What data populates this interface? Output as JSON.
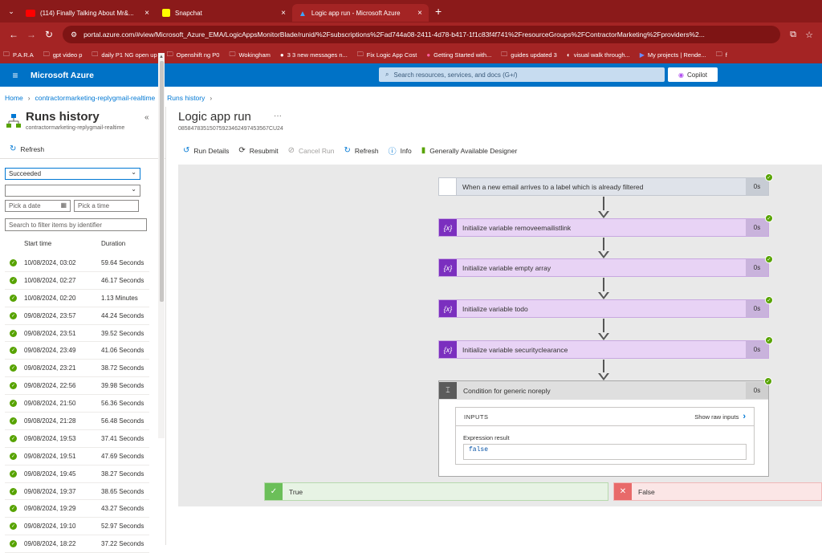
{
  "browser": {
    "tabs": [
      {
        "label": "(114) Finally Talking About Mr&...",
        "icon": "youtube-icon",
        "close": "×"
      },
      {
        "label": "Snapchat",
        "icon": "snapchat-icon",
        "close": "×"
      },
      {
        "label": "Logic app run - Microsoft Azure",
        "icon": "azure-icon",
        "close": "×"
      }
    ],
    "new_tab": "+",
    "url": "portal.azure.com/#view/Microsoft_Azure_EMA/LogicAppsMonitorBlade/runid/%2Fsubscriptions%2Fad744a08-2411-4d78-b417-1f1c83f4f741%2FresourceGroups%2FContractorMarketing%2Fproviders%2...",
    "bookmarks": [
      {
        "label": "P.A.R.A",
        "icon": "folder-icon"
      },
      {
        "label": "gpt video p",
        "icon": "folder-icon"
      },
      {
        "label": "daily P1 NG  open up",
        "icon": "folder-icon"
      },
      {
        "label": "Openshift ng P0",
        "icon": "folder-icon"
      },
      {
        "label": "Wokingham",
        "icon": "folder-icon"
      },
      {
        "label": "3 3 new messages n...",
        "icon": "chat-icon"
      },
      {
        "label": "Fix Logic App Cost",
        "icon": "folder-icon"
      },
      {
        "label": "Getting Started with...",
        "icon": "site-icon"
      },
      {
        "label": "guides updated 3",
        "icon": "folder-icon"
      },
      {
        "label": "visual walk through...",
        "icon": "site-icon"
      },
      {
        "label": "My projects | Rende...",
        "icon": "site-icon"
      },
      {
        "label": "f",
        "icon": "folder-icon"
      }
    ]
  },
  "azure": {
    "brand": "Microsoft Azure",
    "search_placeholder": "Search resources, services, and docs (G+/)",
    "copilot": "Copilot"
  },
  "breadcrumb": [
    "Home",
    "contractormarketing-replygmail-realtime",
    "Runs history"
  ],
  "left": {
    "title": "Runs history",
    "subtitle": "contractormarketing-replygmail-realtime",
    "refresh": "Refresh",
    "status_filter": "Succeeded",
    "second_filter": "",
    "date_placeholder": "Pick a date",
    "time_placeholder": "Pick a time",
    "filter_placeholder": "Search to filter items by identifier",
    "col_start": "Start time",
    "col_duration": "Duration",
    "runs": [
      {
        "start": "10/08/2024, 03:02",
        "duration": "59.64 Seconds"
      },
      {
        "start": "10/08/2024, 02:27",
        "duration": "46.17 Seconds"
      },
      {
        "start": "10/08/2024, 02:20",
        "duration": "1.13 Minutes"
      },
      {
        "start": "09/08/2024, 23:57",
        "duration": "44.24 Seconds"
      },
      {
        "start": "09/08/2024, 23:51",
        "duration": "39.52 Seconds"
      },
      {
        "start": "09/08/2024, 23:49",
        "duration": "41.06 Seconds"
      },
      {
        "start": "09/08/2024, 23:21",
        "duration": "38.72 Seconds"
      },
      {
        "start": "09/08/2024, 22:56",
        "duration": "39.98 Seconds"
      },
      {
        "start": "09/08/2024, 21:50",
        "duration": "56.36 Seconds"
      },
      {
        "start": "09/08/2024, 21:28",
        "duration": "56.48 Seconds"
      },
      {
        "start": "09/08/2024, 19:53",
        "duration": "37.41 Seconds"
      },
      {
        "start": "09/08/2024, 19:51",
        "duration": "47.69 Seconds"
      },
      {
        "start": "09/08/2024, 19:45",
        "duration": "38.27 Seconds"
      },
      {
        "start": "09/08/2024, 19:37",
        "duration": "38.65 Seconds"
      },
      {
        "start": "09/08/2024, 19:29",
        "duration": "43.27 Seconds"
      },
      {
        "start": "09/08/2024, 19:10",
        "duration": "52.97 Seconds"
      },
      {
        "start": "09/08/2024, 18:22",
        "duration": "37.22 Seconds"
      }
    ]
  },
  "main": {
    "title": "Logic app run",
    "more": "···",
    "run_id": "08584783515075923462497453567CU24",
    "toolbar": {
      "run_details": "Run Details",
      "resubmit": "Resubmit",
      "cancel_run": "Cancel Run",
      "refresh": "Refresh",
      "info": "Info",
      "designer": "Generally Available Designer"
    },
    "steps": [
      {
        "label": "When a new email arrives to a label which is already filtered",
        "duration": "0s",
        "icon": "gmail-icon"
      },
      {
        "label": "Initialize variable removeemailistlink",
        "duration": "0s",
        "icon": "variable-icon"
      },
      {
        "label": "Initialize variable empty array",
        "duration": "0s",
        "icon": "variable-icon"
      },
      {
        "label": "Initialize variable todo",
        "duration": "0s",
        "icon": "variable-icon"
      },
      {
        "label": "Initialize variable securityclearance",
        "duration": "0s",
        "icon": "variable-icon"
      }
    ],
    "condition": {
      "label": "Condition for generic noreply",
      "duration": "0s",
      "inputs_label": "INPUTS",
      "show_raw": "Show raw inputs",
      "expr_label": "Expression result",
      "expr_value": "false"
    },
    "branch_true": "True",
    "branch_false": "False"
  },
  "colors": {
    "browser_chrome": "#a42424",
    "azure_header": "#0072c6",
    "success": "#57a300",
    "variable_step": "#e8d3f5",
    "variable_icon": "#7b2fbf"
  }
}
